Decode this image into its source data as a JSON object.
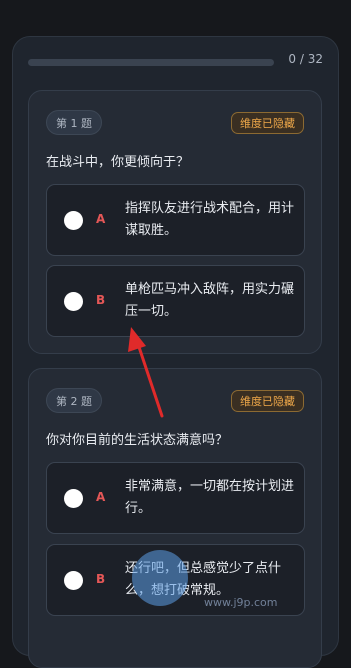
{
  "progress": {
    "text": "0 / 32",
    "value": 0
  },
  "questions": [
    {
      "number": "第 1 题",
      "badge": "维度已隐藏",
      "text": "在战斗中，你更倾向于？",
      "options": [
        {
          "letter": "A",
          "text": "指挥队友进行战术配合，用计谋取胜。"
        },
        {
          "letter": "B",
          "text": "单枪匹马冲入敌阵，用实力碾压一切。"
        }
      ]
    },
    {
      "number": "第 2 题",
      "badge": "维度已隐藏",
      "text": "你对你目前的生活状态满意吗？",
      "options": [
        {
          "letter": "A",
          "text": "非常满意，一切都在按计划进行。"
        },
        {
          "letter": "B",
          "text": "还行吧，但总感觉少了点什么，想打破常规。"
        }
      ]
    }
  ],
  "watermark": {
    "url": "www.j9p.com"
  },
  "colors": {
    "accent_red": "#e45757",
    "badge_orange": "#f0a94a",
    "arrow": "#e02a2a"
  }
}
